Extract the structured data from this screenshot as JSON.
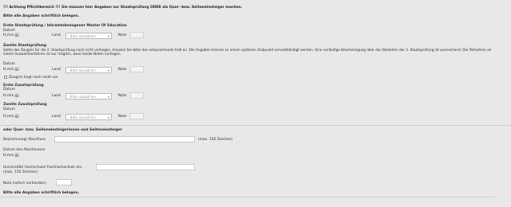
{
  "header": {
    "warning": "!!! Achtung Pflichtbereich !!! Sie müssen hier Angaben zur Staatsprüfung ODER als Quer- bzw. Seiteneinsteiger machen.",
    "instruction": "Bitte alle Angaben schriftlich belegen."
  },
  "sections": {
    "first_exam": {
      "title": "Erste Staatsprüfung / lehramtsbezogener Master Of Education",
      "date_label": "Datum",
      "date_placeholder": "tt.mm.jjjj",
      "land_label": "Land",
      "land_value": "- Bitte auswählen -",
      "note_label": "Note"
    },
    "second_exam": {
      "title": "Zweite Staatsprüfung",
      "description": "Sollte das Zeugnis für die 2. Staatsprüfung noch nicht vorliegen, kreuzen Sie bitte das entsprechende Feld an. Die Angaben können zu einem späteren Zeitpunkt vervollständigt werden. Eine vorläufige Bescheinigung über das Bestehen der 2. Staatsprüfung ist ausreichend. Die Teilnahme an einem Auswahlverfahren ist nur möglich, wenn beide Noten vorliegen.",
      "date_label": "Datum",
      "date_placeholder": "tt.mm.jjjj",
      "land_label": "Land",
      "land_value": "- Bitte auswählen -",
      "note_label": "Note",
      "checkbox_label": "Zeugnis liegt noch nicht vor"
    },
    "first_extra": {
      "title": "Erste Zusatzprüfung",
      "date_label": "Datum",
      "date_placeholder": "tt.mm.jjjj",
      "land_label": "Land",
      "land_value": "- Bitte auswählen -",
      "note_label": "Note"
    },
    "second_extra": {
      "title": "Zweite Zusatzprüfung",
      "date_label": "Datum",
      "date_placeholder": "tt.mm.jjjj",
      "land_label": "Land",
      "land_value": "- Bitte auswählen -",
      "note_label": "Note"
    }
  },
  "quer": {
    "title": "oder Quer- bzw. Seiteneinsteigerinnen und Seiteneinsteiger",
    "bezeichnung_label": "Bezeichnung/ Abschluss",
    "bezeichnung_hint": "(max. 150 Zeichen)",
    "datum_label": "Datum des Abschlusses",
    "datum_placeholder": "tt.mm.jjjj",
    "uni_label": "Universität/ Hochschule/ Fachhochschule etc.",
    "uni_hint": "(max. 150 Zeichen)",
    "note_label": "Note (sofern vorhanden)",
    "instruction": "Bitte alle Angaben schriftlich belegen."
  }
}
